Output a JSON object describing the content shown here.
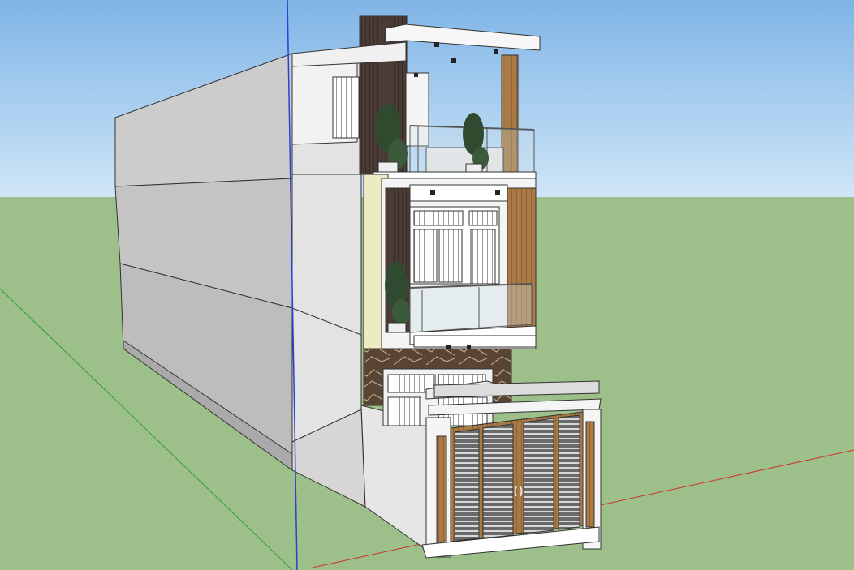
{
  "viewport": {
    "colors": {
      "sky_top": "#7fb4e6",
      "sky_bottom": "#cfe6f7",
      "ground": "#9dbf8a",
      "axis_red": "#d03030",
      "axis_green": "#2fa02f",
      "axis_blue": "#2b3fd6"
    }
  },
  "model": {
    "icons": [
      "building-model",
      "potted-plant",
      "balcony-railing",
      "gate"
    ]
  }
}
